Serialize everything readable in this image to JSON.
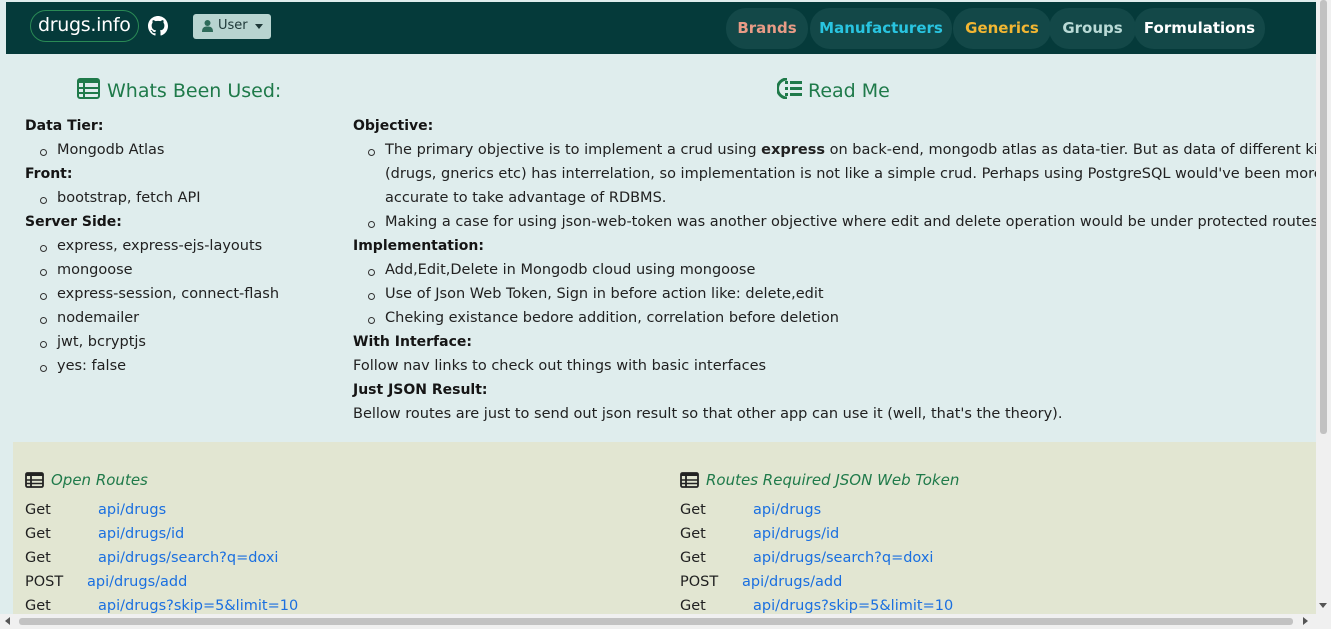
{
  "navbar": {
    "brand": "drugs.info",
    "user_label": "User",
    "links": [
      "Brands",
      "Manufacturers",
      "Generics",
      "Groups",
      "Formulations"
    ],
    "link_colors": {
      "brands": "#e89b86",
      "manufacturers": "#29c4e0",
      "generics": "#f2b632",
      "groups": "#b9dad6",
      "formulations": "#ffffff"
    },
    "background": "#053a3a"
  },
  "used": {
    "title": "Whats Been Used:",
    "data_tier_label": "Data Tier:",
    "data_tier": [
      "Mongodb Atlas"
    ],
    "front_label": "Front:",
    "front": [
      "bootstrap, fetch API"
    ],
    "server_label": "Server Side:",
    "server": [
      "express, express-ejs-layouts",
      "mongoose",
      "express-session, connect-flash",
      "nodemailer",
      "jwt, bcryptjs",
      "yes: false"
    ]
  },
  "readme": {
    "title": "Read Me",
    "objective_label": "Objective:",
    "objective_1_pre": "The primary objective is to implement a crud using",
    "objective_1_bold": "express",
    "objective_1_post": "on back-end, mongodb atlas as data-tier. But as data of different kinds",
    "objective_1_line2": "(drugs, gnerics etc) has interrelation, so implementation is not like a simple crud. Perhaps using PostgreSQL would've been more",
    "objective_1_line3": "accurate to take advantage of RDBMS.",
    "objective_2": "Making a case for using json-web-token was another objective where edit and delete operation would be under protected routes.",
    "implementation_label": "Implementation:",
    "implementation": [
      "Add,Edit,Delete in Mongodb cloud using mongoose",
      "Use of Json Web Token, Sign in before action like: delete,edit",
      "Cheking existance bedore addition, correlation before deletion"
    ],
    "interface_label": "With Interface:",
    "interface_text": "Follow nav links to check out things with basic interfaces",
    "json_label": "Just JSON Result:",
    "json_text": "Bellow routes are just to send out json result so that other app can use it (well, that's the theory)."
  },
  "routes": {
    "open_title": "Open Routes",
    "jwt_title": "Routes Required JSON Web Token",
    "open": [
      {
        "method": "Get",
        "path": "api/drugs"
      },
      {
        "method": "Get",
        "path": "api/drugs/id"
      },
      {
        "method": "Get",
        "path": "api/drugs/search?q=doxi"
      },
      {
        "method": "POST",
        "path": "api/drugs/add"
      },
      {
        "method": "Get",
        "path": "api/drugs?skip=5&limit=10"
      }
    ],
    "jwt": [
      {
        "method": "Get",
        "path": "api/drugs"
      },
      {
        "method": "Get",
        "path": "api/drugs/id"
      },
      {
        "method": "Get",
        "path": "api/drugs/search?q=doxi"
      },
      {
        "method": "POST",
        "path": "api/drugs/add"
      },
      {
        "method": "Get",
        "path": "api/drugs?skip=5&limit=10"
      }
    ]
  }
}
